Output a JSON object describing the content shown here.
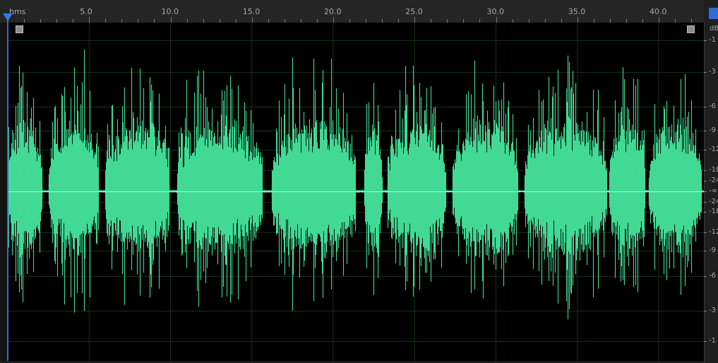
{
  "ruler": {
    "unit": "hms",
    "ticks": [
      "5.0",
      "10.0",
      "15.0",
      "20.0",
      "25.0",
      "30.0",
      "35.0",
      "40.0"
    ]
  },
  "db_scale": {
    "unit": "dB",
    "labels": [
      "-1",
      "-3",
      "-6",
      "-9",
      "-12",
      "-18",
      "-24",
      "-∞",
      "-24",
      "-18",
      "-12",
      "-9",
      "-6",
      "-3",
      "-1"
    ]
  },
  "colors": {
    "waveform": "#41d994",
    "background": "#000000",
    "grid": "#143214",
    "playhead": "#2e7be6"
  },
  "icons": {
    "playhead": "playhead-marker-icon",
    "fade_in": "fade-in-handle-icon",
    "fade_out": "fade-out-handle-icon",
    "headphone": "headphone-icon"
  }
}
